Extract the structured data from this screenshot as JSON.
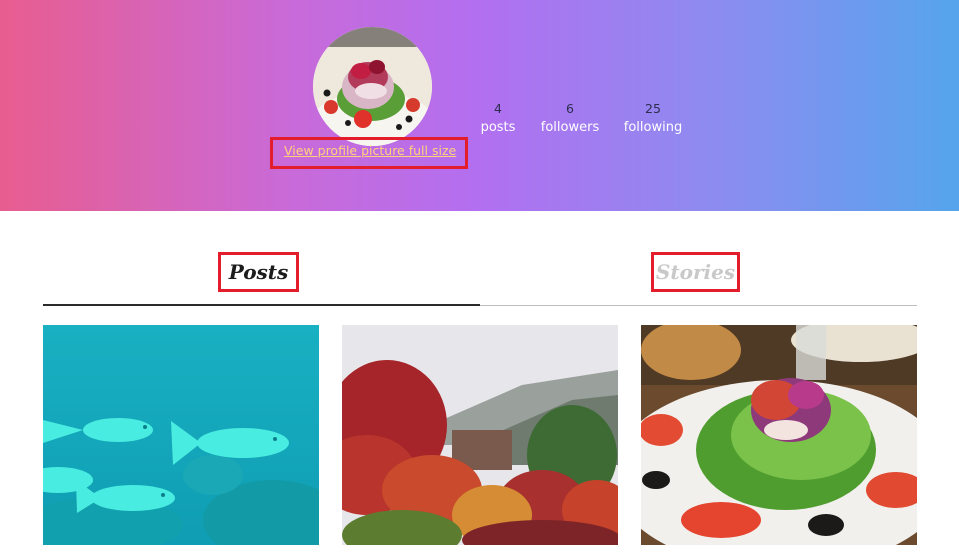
{
  "profile": {
    "avatar_icon": "salad-photo",
    "full_size_link": "View profile picture full size",
    "highlight_color": "#e41d2d",
    "gradient": [
      "#e85d8f",
      "#b26ff0",
      "#55a5ec"
    ]
  },
  "stats": [
    {
      "value": "4",
      "label": "posts"
    },
    {
      "value": "6",
      "label": "followers"
    },
    {
      "value": "25",
      "label": "following"
    }
  ],
  "tabs": [
    {
      "label": "Posts",
      "active": true
    },
    {
      "label": "Stories",
      "active": false
    }
  ],
  "posts": [
    {
      "subject": "fish-underwater-photo"
    },
    {
      "subject": "autumn-forest-photo"
    },
    {
      "subject": "salad-plate-photo"
    }
  ]
}
